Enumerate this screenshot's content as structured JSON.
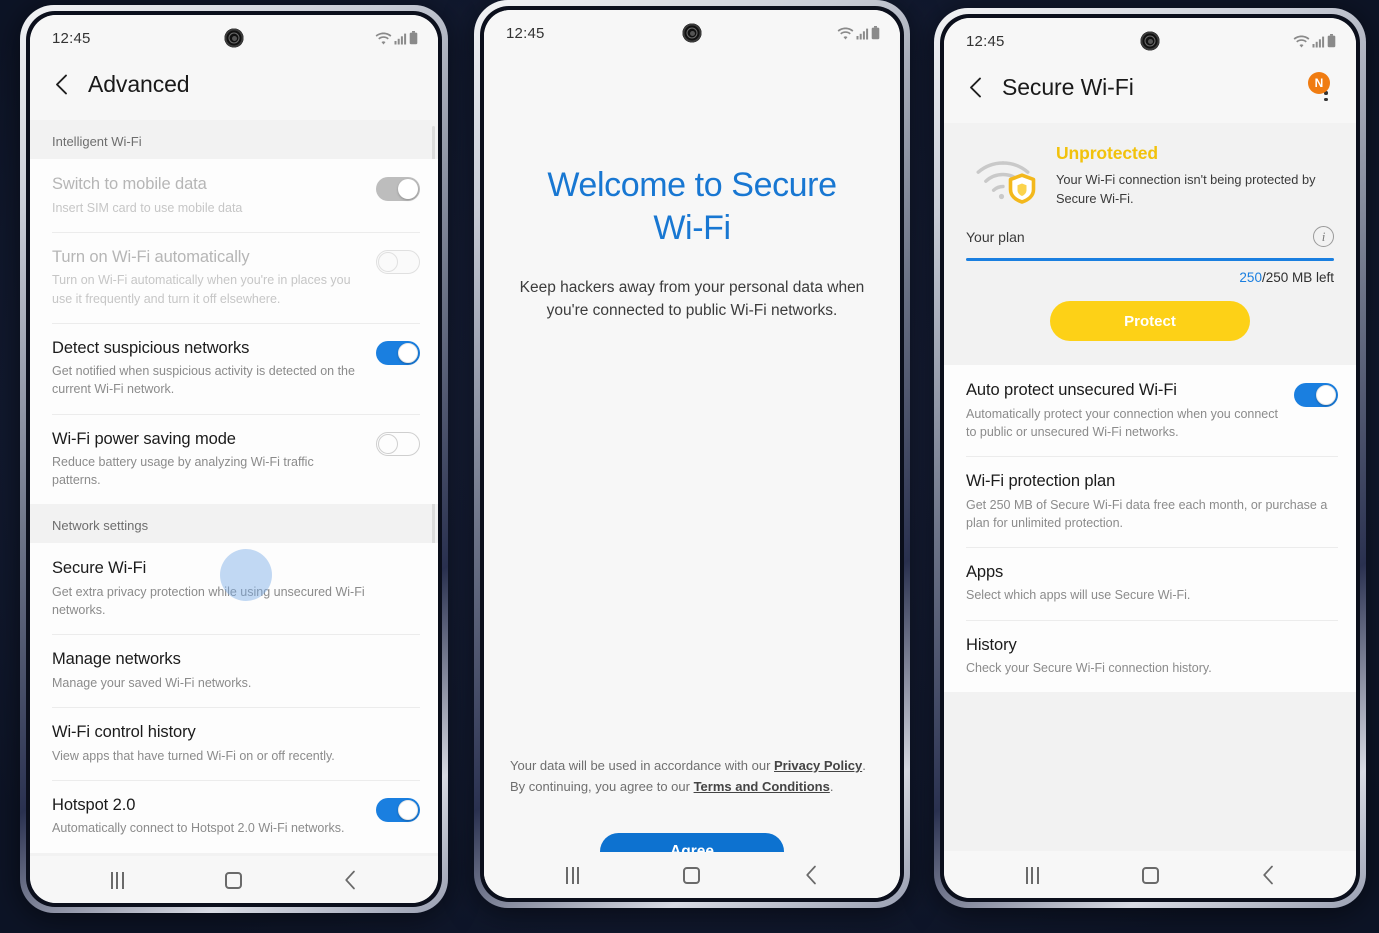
{
  "background_color": "#121a30",
  "accent_blue": "#1a7fe0",
  "accent_yellow": "#fdd117",
  "status_bar": {
    "time": "12:45",
    "icons": [
      "wifi-icon",
      "cellular-signal-icon",
      "battery-icon"
    ]
  },
  "nav_bar": {
    "recent_label": "recent-apps",
    "home_label": "home",
    "back_label": "back"
  },
  "phone1": {
    "header": {
      "title": "Advanced",
      "back_icon": "chevron-left-icon"
    },
    "sections": [
      {
        "label": "Intelligent Wi-Fi",
        "rows": [
          {
            "title": "Switch to mobile data",
            "subtitle": "Insert SIM card to use mobile data",
            "toggle": "on-disabled",
            "dim": true
          },
          {
            "title": "Turn on Wi-Fi automatically",
            "subtitle": "Turn on Wi-Fi automatically when you're in places you use it frequently and turn it off elsewhere.",
            "toggle": "off-disabled",
            "dim": true
          },
          {
            "title": "Detect suspicious networks",
            "subtitle": "Get notified when suspicious activity is detected on the current Wi-Fi network.",
            "toggle": "on",
            "dim": false
          },
          {
            "title": "Wi-Fi power saving mode",
            "subtitle": "Reduce battery usage by analyzing Wi-Fi traffic patterns.",
            "toggle": "off",
            "dim": false
          }
        ]
      },
      {
        "label": "Network settings",
        "rows": [
          {
            "title": "Secure Wi-Fi",
            "subtitle": "Get extra privacy protection while using unsecured Wi-Fi networks.",
            "toggle": "none",
            "dim": false,
            "touched": true
          },
          {
            "title": "Manage networks",
            "subtitle": "Manage your saved Wi-Fi networks.",
            "toggle": "none",
            "dim": false
          },
          {
            "title": "Wi-Fi control history",
            "subtitle": "View apps that have turned Wi-Fi on or off recently.",
            "toggle": "none",
            "dim": false
          },
          {
            "title": "Hotspot 2.0",
            "subtitle": "Automatically connect to Hotspot 2.0 Wi-Fi networks.",
            "toggle": "on",
            "dim": false
          }
        ]
      }
    ]
  },
  "phone2": {
    "title": "Welcome to Secure Wi-Fi",
    "subtitle": "Keep hackers away from your personal data when you're connected to public Wi-Fi networks.",
    "legal": {
      "part1": "Your data will be used in accordance with our ",
      "link1": "Privacy Policy",
      "part2": ". By continuing, you agree to our ",
      "link2": "Terms and Conditions",
      "part3": "."
    },
    "agree_button": "Agree"
  },
  "phone3": {
    "header": {
      "title": "Secure Wi-Fi",
      "back_icon": "chevron-left-icon",
      "menu_icon": "more-vertical-icon",
      "badge": "N"
    },
    "status": {
      "icon": "wifi-shield-unprotected-icon",
      "title": "Unprotected",
      "description": "Your Wi-Fi connection isn't being protected by Secure Wi-Fi."
    },
    "plan": {
      "label": "Your plan",
      "info_icon": "info-icon",
      "remaining": "250",
      "total_suffix": "/250 MB left",
      "progress_percent": 100
    },
    "protect_button": "Protect",
    "rows": [
      {
        "title": "Auto protect unsecured Wi-Fi",
        "subtitle": "Automatically protect your connection when you connect to public or unsecured Wi-Fi networks.",
        "toggle": "on"
      },
      {
        "title": "Wi-Fi protection plan",
        "subtitle": "Get 250 MB of Secure Wi-Fi data free each month, or purchase a plan for unlimited protection.",
        "toggle": "none"
      },
      {
        "title": "Apps",
        "subtitle": "Select which apps will use Secure Wi-Fi.",
        "toggle": "none"
      },
      {
        "title": "History",
        "subtitle": "Check your Secure Wi-Fi connection history.",
        "toggle": "none"
      }
    ]
  }
}
